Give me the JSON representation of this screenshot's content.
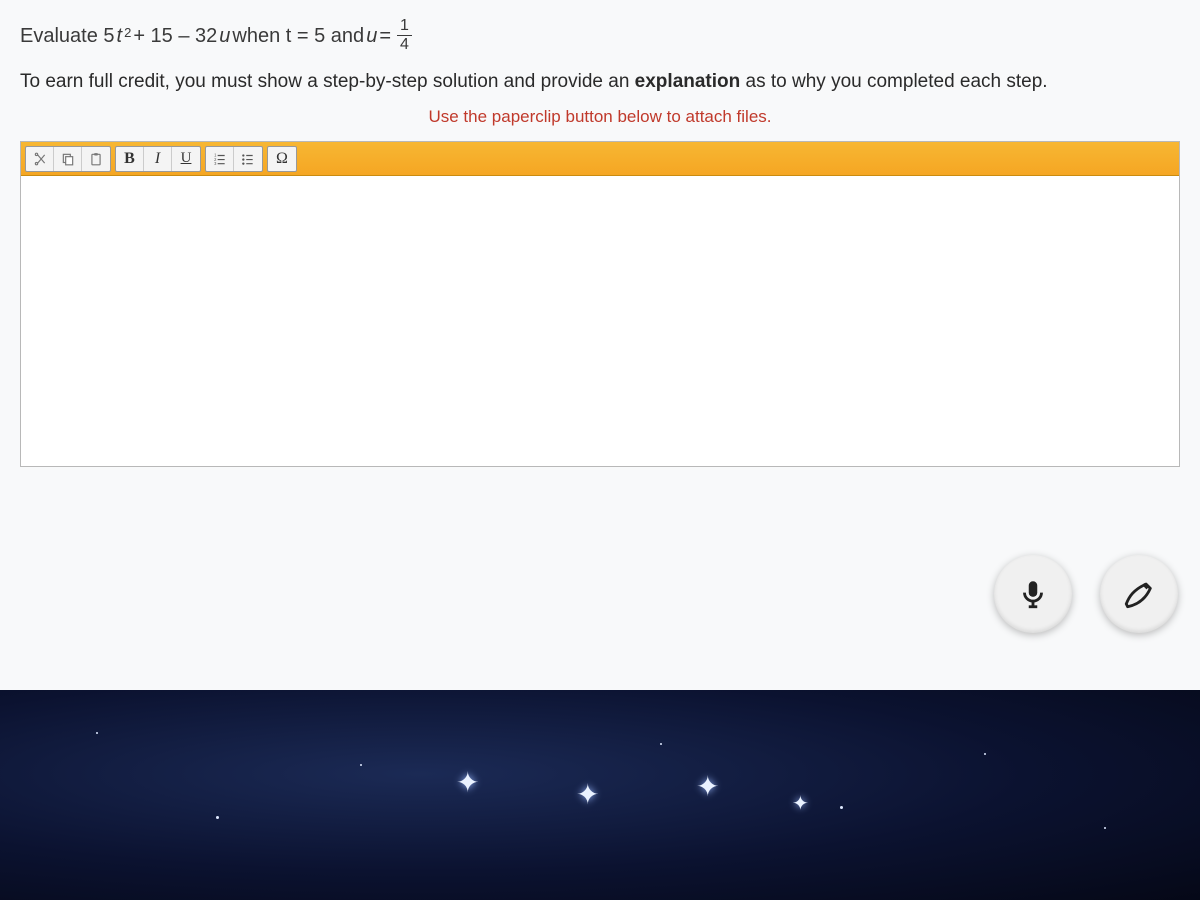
{
  "question": {
    "prefix": "Evaluate 5",
    "var1": "t",
    "exp": "2",
    "mid1": " + 15 – 32",
    "var2": "u",
    "mid2": " when t = 5 and ",
    "var3": "u",
    "eq": " = ",
    "frac_num": "1",
    "frac_den": "4"
  },
  "instruction": {
    "pre": "To earn full credit, you must show a step-by-step solution and provide an ",
    "strong": "explanation",
    "post": " as to why you completed each step."
  },
  "hint": "Use the paperclip button below to attach files.",
  "toolbar": {
    "bold": "B",
    "italic": "I",
    "underline": "U",
    "omega": "Ω"
  }
}
